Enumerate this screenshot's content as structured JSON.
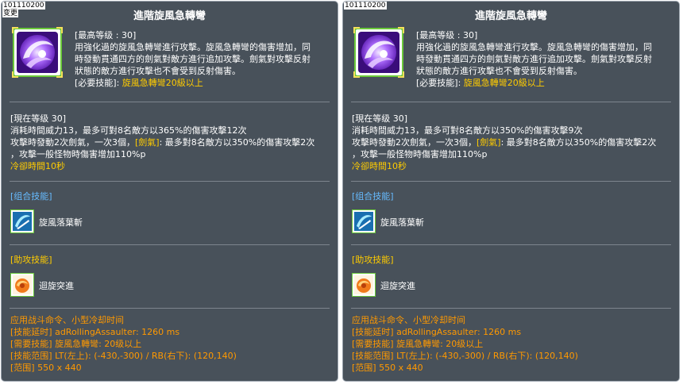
{
  "panels": [
    {
      "skill_id": "101110200",
      "diff_label": "变更",
      "title": "進階旋風急轉彎",
      "max_level": "[最高等级 : 30]",
      "desc_lines": [
        "用強化過的旋風急轉彎進行攻擊。旋風急轉彎的傷害增加，同",
        "時發動貫通四方的劍氣對敵方進行追加攻擊。劍氣對攻擊反射",
        "狀態的敵方進行攻擊也不會受到反射傷害。"
      ],
      "req_label": "[必要技能]: ",
      "req_value": "旋風急轉彎20級以上",
      "cur_level": "[現在等级 30]",
      "cur_line1": "消耗時間威力13，最多可對8名敵方以365%的傷害攻擊12次",
      "cur_line2_a": "攻擊時發動2次劍氣，一次3個，",
      "cur_line2_b": "[劍氣]",
      "cur_line2_c": ": 最多對8名敵方以350%的傷害攻擊2次",
      "cur_line3": "，攻擊一般怪物時傷害增加110%p",
      "cooldown": "冷卻時間10秒",
      "combo_header": "[组合技能]",
      "combo_skill": "旋風落葉斬",
      "assist_header": "[助攻技能]",
      "assist_skill": "迴旋突進",
      "footer": [
        "应用战斗命令、小型冷却时间",
        "[技能延时] adRollingAssaulter: 1260 ms",
        "[需要技能] 旋風急轉彎: 20级以上",
        "[技能范围] LT(左上): (-430,-300) / RB(右下): (120,140)",
        "[范围] 550 x 440"
      ]
    },
    {
      "skill_id": "101110200",
      "diff_label": "",
      "title": "進階旋風急轉彎",
      "max_level": "[最高等级 : 30]",
      "desc_lines": [
        "用強化過的旋風急轉彎進行攻擊。旋風急轉彎的傷害增加，同",
        "時發動貫通四方的劍氣對敵方進行追加攻擊。劍氣對攻擊反射",
        "狀態的敵方進行攻擊也不會受到反射傷害。"
      ],
      "req_label": "[必要技能]: ",
      "req_value": "旋風急轉彎20級以上",
      "cur_level": "[現在等级 30]",
      "cur_line1": "消耗時間威力13，最多可對8名敵方以350%的傷害攻擊9次",
      "cur_line2_a": "攻擊時發動2次劍氣，一次3個，",
      "cur_line2_b": "[劍氣]",
      "cur_line2_c": ": 最多對8名敵方以350%的傷害攻擊2次",
      "cur_line3": "，攻擊一般怪物時傷害增加110%p",
      "cooldown": "冷卻時間10秒",
      "combo_header": "[组合技能]",
      "combo_skill": "旋風落葉斬",
      "assist_header": "[助攻技能]",
      "assist_skill": "迴旋突進",
      "footer": [
        "应用战斗命令、小型冷却时间",
        "[技能延时] adRollingAssaulter: 1260 ms",
        "[需要技能] 旋風急轉彎: 20级以上",
        "[技能范围] LT(左上): (-430,-300) / RB(右下): (120,140)",
        "[范围] 550 x 440"
      ]
    }
  ],
  "colors": {
    "panel_bg": "#48515a",
    "highlight_yellow": "#ffcc00",
    "footer_orange": "#ff9900",
    "header_blue": "#66bbff"
  },
  "icons": {
    "main": "purple-whirlwind-skill-icon",
    "combo": "blue-blade-slash-icon",
    "assist": "orange-spin-rush-icon"
  }
}
